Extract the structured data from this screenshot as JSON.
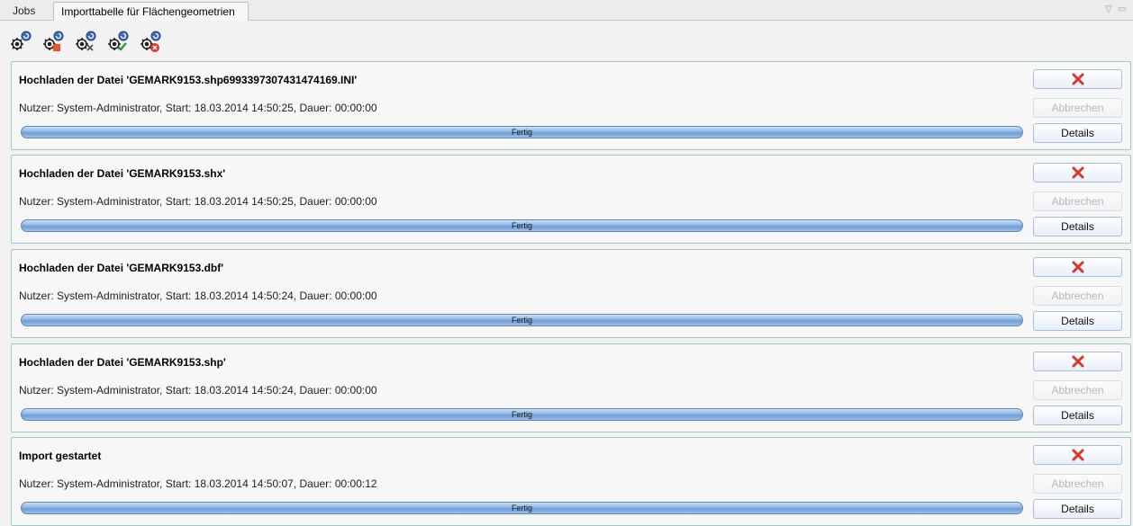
{
  "tabs": [
    {
      "label": "Jobs"
    },
    {
      "label": "Importtabelle für Flächengeometrien"
    }
  ],
  "window_controls": {
    "minimize": "▽",
    "maximize": "▭"
  },
  "toolbar": {
    "icons": [
      "jobs-refresh-icon",
      "jobs-error-icon",
      "jobs-cancelled-icon",
      "jobs-ok-icon",
      "jobs-delete-icon"
    ]
  },
  "jobs": [
    {
      "title": "Hochladen der Datei 'GEMARK9153.shp6993397307431474169.INI'",
      "info": "Nutzer: System-Administrator, Start: 18.03.2014 14:50:25, Dauer: 00:00:00",
      "progress": 1.0,
      "status": "Fertig",
      "cancel_label": "Abbrechen",
      "details_label": "Details"
    },
    {
      "title": "Hochladen der Datei 'GEMARK9153.shx'",
      "info": "Nutzer: System-Administrator, Start: 18.03.2014 14:50:25, Dauer: 00:00:00",
      "progress": 1.0,
      "status": "Fertig",
      "cancel_label": "Abbrechen",
      "details_label": "Details"
    },
    {
      "title": "Hochladen der Datei 'GEMARK9153.dbf'",
      "info": "Nutzer: System-Administrator, Start: 18.03.2014 14:50:24, Dauer: 00:00:00",
      "progress": 1.0,
      "status": "Fertig",
      "cancel_label": "Abbrechen",
      "details_label": "Details"
    },
    {
      "title": "Hochladen der Datei 'GEMARK9153.shp'",
      "info": "Nutzer: System-Administrator, Start: 18.03.2014 14:50:24, Dauer: 00:00:00",
      "progress": 1.0,
      "status": "Fertig",
      "cancel_label": "Abbrechen",
      "details_label": "Details"
    },
    {
      "title": "Import gestartet",
      "info": "Nutzer: System-Administrator, Start: 18.03.2014 14:50:07, Dauer: 00:00:12",
      "progress": 1.0,
      "status": "Fertig",
      "cancel_label": "Abbrechen",
      "details_label": "Details"
    }
  ],
  "colors": {
    "remove_icon": "#d9372b",
    "progress": "#7aa6dc",
    "panel_border": "#9ec9c9"
  }
}
